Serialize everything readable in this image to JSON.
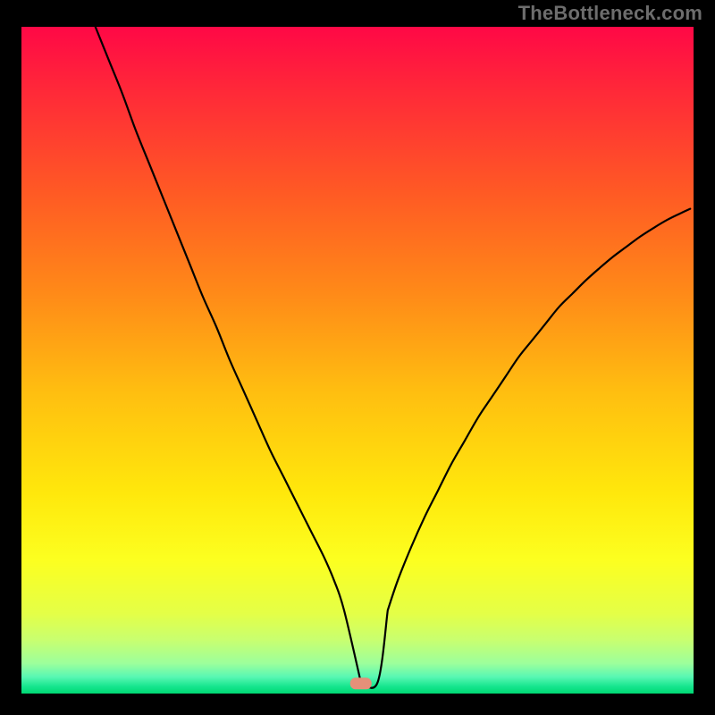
{
  "watermark": "TheBottleneck.com",
  "chart_data": {
    "type": "line",
    "title": "",
    "xlabel": "",
    "ylabel": "",
    "xlim": [
      0,
      100
    ],
    "ylim": [
      0,
      100
    ],
    "grid": false,
    "legend": false,
    "background": "rainbow-vertical",
    "annotations": [
      {
        "kind": "marker",
        "shape": "rounded-pill",
        "x": 50.5,
        "y": 1.5,
        "color": "#e59079"
      }
    ],
    "series": [
      {
        "name": "bottleneck-curve",
        "stroke": "#000000",
        "stroke_width": 2,
        "x": [
          11,
          13,
          15,
          17,
          19,
          21,
          23,
          25,
          27,
          29,
          31,
          33,
          35,
          37,
          39,
          41,
          43,
          45,
          46.5,
          48,
          50.5,
          53,
          54.5,
          56,
          58,
          60,
          62,
          64,
          66,
          68,
          70,
          72,
          74,
          76,
          78,
          80,
          82,
          84,
          86,
          88,
          90,
          92,
          94,
          96,
          98,
          99.5
        ],
        "y": [
          100,
          95,
          90,
          84.5,
          79.5,
          74.5,
          69.5,
          64.5,
          59.5,
          55,
          50,
          45.5,
          41,
          36.5,
          32.5,
          28.5,
          24.5,
          20.5,
          17,
          12.5,
          1.7,
          1.7,
          12.5,
          17,
          22,
          26.5,
          30.5,
          34.5,
          38,
          41.5,
          44.5,
          47.5,
          50.5,
          53,
          55.5,
          58,
          60,
          62,
          63.8,
          65.5,
          67,
          68.5,
          69.8,
          71,
          72,
          72.7
        ]
      }
    ],
    "gradient_stops": [
      {
        "pos": 0.0,
        "color": "#ff0846"
      },
      {
        "pos": 0.1,
        "color": "#ff2a38"
      },
      {
        "pos": 0.25,
        "color": "#ff5a24"
      },
      {
        "pos": 0.4,
        "color": "#ff8a18"
      },
      {
        "pos": 0.55,
        "color": "#ffbf10"
      },
      {
        "pos": 0.7,
        "color": "#ffe80c"
      },
      {
        "pos": 0.8,
        "color": "#fcff20"
      },
      {
        "pos": 0.88,
        "color": "#e4ff47"
      },
      {
        "pos": 0.92,
        "color": "#c8ff70"
      },
      {
        "pos": 0.955,
        "color": "#9cff9c"
      },
      {
        "pos": 0.975,
        "color": "#58f7b3"
      },
      {
        "pos": 0.99,
        "color": "#14e58c"
      },
      {
        "pos": 1.0,
        "color": "#00d873"
      }
    ]
  }
}
